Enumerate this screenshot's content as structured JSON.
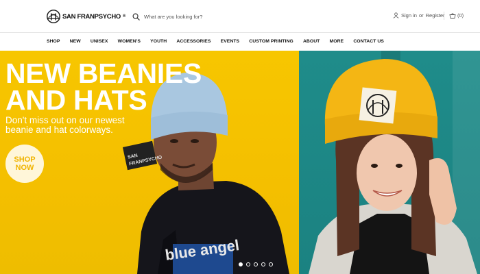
{
  "brand": {
    "name": "SAN FRANPSYCHO",
    "mark": "®"
  },
  "search": {
    "placeholder": "What are you looking for?"
  },
  "account": {
    "sign_in": "Sign in",
    "or": "or",
    "register": "Register"
  },
  "cart": {
    "count": "(0)"
  },
  "nav": {
    "items": [
      "SHOP",
      "NEW",
      "UNISEX",
      "WOMEN'S",
      "YOUTH",
      "ACCESSORIES",
      "EVENTS",
      "CUSTOM PRINTING",
      "ABOUT",
      "MORE",
      "CONTACT US"
    ]
  },
  "hero": {
    "title_line1": "NEW BEANIES",
    "title_line2": "AND HATS",
    "subtitle": "Don't miss out on our newest beanie and hat colorways.",
    "cta_line1": "SHOP",
    "cta_line2": "NOW",
    "slides": 5,
    "active_slide": 1
  },
  "colors": {
    "accent_yellow": "#f7c600",
    "teal": "#1f8c8a",
    "cta_text": "#f0b400"
  },
  "icons": [
    "bridge-logo-icon",
    "search-icon",
    "user-icon",
    "cart-icon"
  ]
}
